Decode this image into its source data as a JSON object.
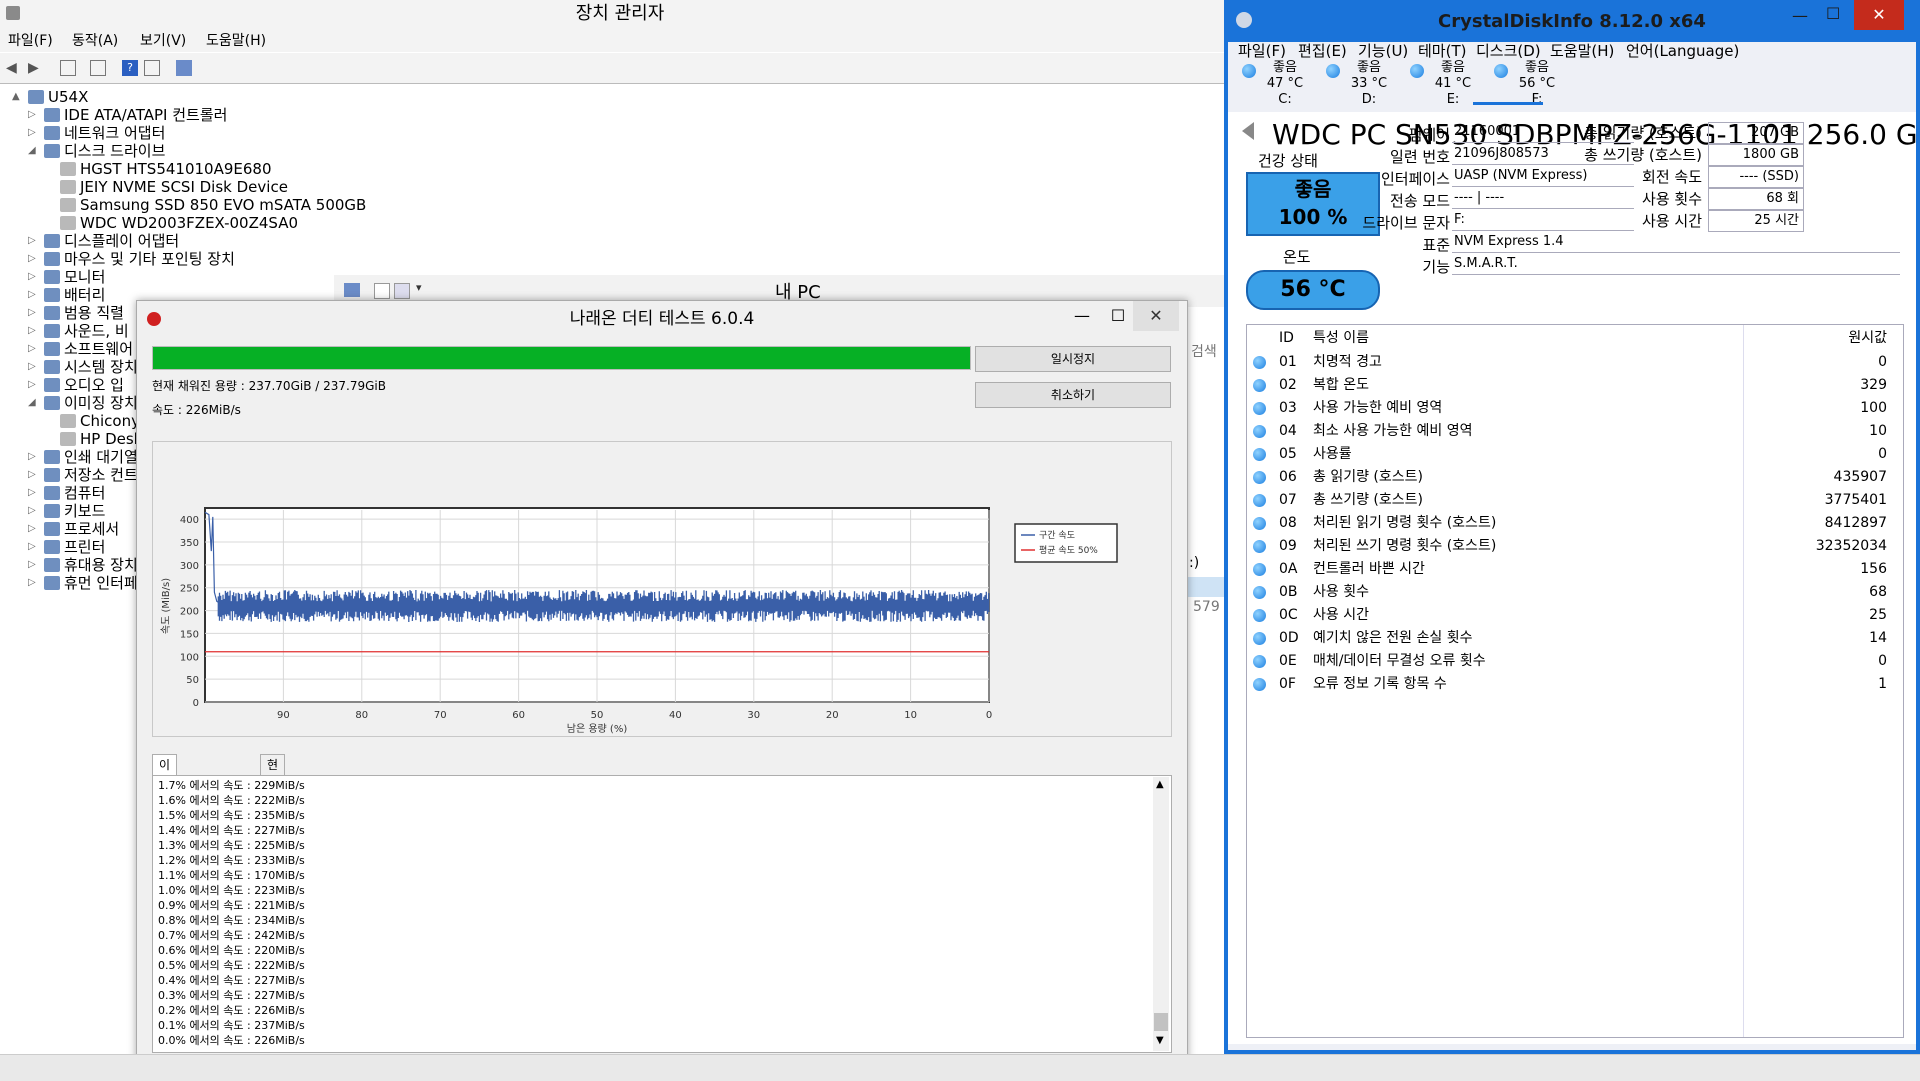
{
  "device_manager": {
    "title": "장치 관리자",
    "menu": [
      "파일(F)",
      "동작(A)",
      "보기(V)",
      "도움말(H)"
    ],
    "tree": [
      {
        "label": "U54X",
        "level": 0,
        "expander": "▲"
      },
      {
        "label": "IDE ATA/ATAPI 컨트롤러",
        "level": 1,
        "expander": "▷"
      },
      {
        "label": "네트워크 어댑터",
        "level": 1,
        "expander": "▷"
      },
      {
        "label": "디스크 드라이브",
        "level": 1,
        "expander": "◢"
      },
      {
        "label": "HGST HTS541010A9E680",
        "level": 2,
        "expander": ""
      },
      {
        "label": "JEIY NVME SCSI Disk Device",
        "level": 2,
        "expander": ""
      },
      {
        "label": "Samsung SSD 850 EVO mSATA 500GB",
        "level": 2,
        "expander": ""
      },
      {
        "label": "WDC WD2003FZEX-00Z4SA0",
        "level": 2,
        "expander": ""
      },
      {
        "label": "디스플레이 어댑터",
        "level": 1,
        "expander": "▷"
      },
      {
        "label": "마우스 및 기타 포인팅 장치",
        "level": 1,
        "expander": "▷"
      },
      {
        "label": "모니터",
        "level": 1,
        "expander": "▷"
      },
      {
        "label": "배터리",
        "level": 1,
        "expander": "▷"
      },
      {
        "label": "범용 직렬",
        "level": 1,
        "expander": "▷"
      },
      {
        "label": "사운드, 비",
        "level": 1,
        "expander": "▷"
      },
      {
        "label": "소프트웨어",
        "level": 1,
        "expander": "▷"
      },
      {
        "label": "시스템 장치",
        "level": 1,
        "expander": "▷"
      },
      {
        "label": "오디오 입",
        "level": 1,
        "expander": "▷"
      },
      {
        "label": "이미징 장치",
        "level": 1,
        "expander": "◢"
      },
      {
        "label": "Chicony",
        "level": 2,
        "expander": ""
      },
      {
        "label": "HP Desl",
        "level": 2,
        "expander": ""
      },
      {
        "label": "인쇄 대기열",
        "level": 1,
        "expander": "▷"
      },
      {
        "label": "저장소 컨트",
        "level": 1,
        "expander": "▷"
      },
      {
        "label": "컴퓨터",
        "level": 1,
        "expander": "▷"
      },
      {
        "label": "키보드",
        "level": 1,
        "expander": "▷"
      },
      {
        "label": "프로세서",
        "level": 1,
        "expander": "▷"
      },
      {
        "label": "프린터",
        "level": 1,
        "expander": "▷"
      },
      {
        "label": "휴대용 장치",
        "level": 1,
        "expander": "▷"
      },
      {
        "label": "휴먼 인터페",
        "level": 1,
        "expander": "▷"
      }
    ]
  },
  "my_pc": {
    "title": "내 PC",
    "search_fragment": "검색",
    "fragment_1": ":)",
    "fragment_2": "579"
  },
  "dirty_test": {
    "title": "나래온 더티 테스트 6.0.4",
    "progress_percent": 99.96,
    "filled_text": "현재 채워진 용량 : 237.70GiB / 237.79GiB",
    "speed_text": "속도 : 226MiB/s",
    "pause_label": "일시정지",
    "cancel_label": "취소하기",
    "tabs": [
      "이전 + 현재 회차",
      "현재 회차"
    ],
    "log": [
      "1.7% 에서의 속도 : 229MiB/s",
      "1.6% 에서의 속도 : 222MiB/s",
      "1.5% 에서의 속도 : 235MiB/s",
      "1.4% 에서의 속도 : 227MiB/s",
      "1.3% 에서의 속도 : 225MiB/s",
      "1.2% 에서의 속도 : 233MiB/s",
      "1.1% 에서의 속도 : 170MiB/s",
      "1.0% 에서의 속도 : 223MiB/s",
      "0.9% 에서의 속도 : 221MiB/s",
      "0.8% 에서의 속도 : 234MiB/s",
      "0.7% 에서의 속도 : 242MiB/s",
      "0.6% 에서의 속도 : 220MiB/s",
      "0.5% 에서의 속도 : 222MiB/s",
      "0.4% 에서의 속도 : 227MiB/s",
      "0.3% 에서의 속도 : 227MiB/s",
      "0.2% 에서의 속도 : 226MiB/s",
      "0.1% 에서의 속도 : 237MiB/s",
      "0.0% 에서의 속도 : 226MiB/s"
    ],
    "chart_data": {
      "type": "line",
      "xlabel": "남은 용량 (%)",
      "ylabel": "속도 (MiB/s)",
      "xlim": [
        100,
        0
      ],
      "ylim": [
        0,
        420
      ],
      "x_ticks": [
        90,
        80,
        70,
        60,
        50,
        40,
        30,
        20,
        10,
        0
      ],
      "y_ticks": [
        0,
        50,
        100,
        150,
        200,
        250,
        300,
        350,
        400
      ],
      "grid": true,
      "legend_position": "top-right",
      "series": [
        {
          "name": "구간 속도",
          "color": "#3a5fa8",
          "x": [
            100,
            99.5,
            99.2,
            99.0,
            98.8,
            98.5,
            98.0,
            95,
            90,
            80,
            70,
            60,
            50,
            40,
            30,
            20,
            10,
            5,
            1,
            0
          ],
          "y": [
            415,
            410,
            330,
            405,
            240,
            220,
            215,
            218,
            220,
            218,
            217,
            219,
            218,
            220,
            217,
            218,
            219,
            218,
            215,
            215
          ],
          "band_min": 175,
          "band_max": 245
        },
        {
          "name": "평균 속도 50%",
          "color": "#e03030",
          "x": [
            100,
            0
          ],
          "y": [
            110,
            110
          ]
        }
      ]
    }
  },
  "crystaldisk": {
    "title": "CrystalDiskInfo 8.12.0 x64",
    "menu": [
      "파일(F)",
      "편집(E)",
      "기능(U)",
      "테마(T)",
      "디스크(D)",
      "도움말(H)",
      "언어(Language)"
    ],
    "drives": [
      {
        "status": "좋음",
        "temp": "47 °C",
        "letter": "C:"
      },
      {
        "status": "좋음",
        "temp": "33 °C",
        "letter": "D:"
      },
      {
        "status": "좋음",
        "temp": "41 °C",
        "letter": "E:"
      },
      {
        "status": "좋음",
        "temp": "56 °C",
        "letter": "F:"
      }
    ],
    "model": "WDC PC SN530 SDBPMPZ-256G-1101 256.0 GB",
    "health_label": "건강 상태",
    "health_status": "좋음",
    "health_percent": "100 %",
    "temp_label": "온도",
    "temp_value": "56 °C",
    "info": {
      "firmware_label": "펌웨어",
      "firmware": "21160001",
      "serial_label": "일련 번호",
      "serial": "21096J808573",
      "interface_label": "인터페이스",
      "interface": "UASP (NVM Express)",
      "transfer_label": "전송 모드",
      "transfer": "---- | ----",
      "letter_label": "드라이브 문자",
      "letter": "F:",
      "standard_label": "표준",
      "standard": "NVM Express 1.4",
      "features_label": "기능",
      "features": "S.M.A.R.T.",
      "reads_label": "총 읽기량 (호스트)",
      "reads": "207 GB",
      "writes_label": "총 쓰기량 (호스트)",
      "writes": "1800 GB",
      "rpm_label": "회전 속도",
      "rpm": "---- (SSD)",
      "count_label": "사용 횟수",
      "count": "68 회",
      "hours_label": "사용 시간",
      "hours": "25 시간"
    },
    "smart_headers": {
      "id": "ID",
      "name": "특성 이름",
      "raw": "원시값"
    },
    "smart": [
      {
        "id": "01",
        "name": "치명적 경고",
        "raw": "0"
      },
      {
        "id": "02",
        "name": "복합 온도",
        "raw": "329"
      },
      {
        "id": "03",
        "name": "사용 가능한 예비 영역",
        "raw": "100"
      },
      {
        "id": "04",
        "name": "최소 사용 가능한 예비 영역",
        "raw": "10"
      },
      {
        "id": "05",
        "name": "사용률",
        "raw": "0"
      },
      {
        "id": "06",
        "name": "총 읽기량 (호스트)",
        "raw": "435907"
      },
      {
        "id": "07",
        "name": "총 쓰기량 (호스트)",
        "raw": "3775401"
      },
      {
        "id": "08",
        "name": "처리된 읽기 명령 횟수 (호스트)",
        "raw": "8412897"
      },
      {
        "id": "09",
        "name": "처리된 쓰기 명령 횟수 (호스트)",
        "raw": "32352034"
      },
      {
        "id": "0A",
        "name": "컨트롤러 바쁜 시간",
        "raw": "156"
      },
      {
        "id": "0B",
        "name": "사용 횟수",
        "raw": "68"
      },
      {
        "id": "0C",
        "name": "사용 시간",
        "raw": "25"
      },
      {
        "id": "0D",
        "name": "예기치 않은 전원 손실 횟수",
        "raw": "14"
      },
      {
        "id": "0E",
        "name": "매체/데이터 무결성 오류 횟수",
        "raw": "0"
      },
      {
        "id": "0F",
        "name": "오류 정보 기록 항목 수",
        "raw": "1"
      }
    ]
  }
}
